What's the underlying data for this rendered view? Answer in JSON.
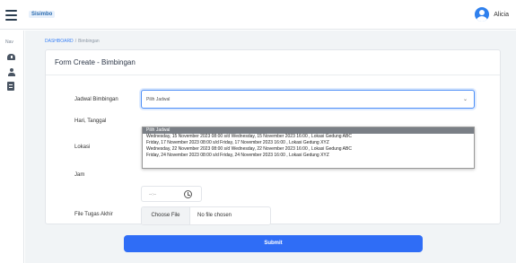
{
  "header": {
    "brand": "Sisimbo",
    "user_name": "Alicia"
  },
  "sidebar": {
    "nav_label": "Nav",
    "items": [
      "dashboard-icon",
      "user-icon",
      "document-icon"
    ]
  },
  "breadcrumb": {
    "home": "DASHBOARD",
    "separator": "/",
    "current": "Bimbingan"
  },
  "form": {
    "title": "Form Create - Bimbingan",
    "labels": {
      "jadwal": "Jadwal Bimbingan",
      "hari": "Hari, Tanggal",
      "lokasi": "Lokasi",
      "jam": "Jam",
      "file": "File Tugas Akhir"
    },
    "jadwal_select": {
      "value": "Pilih Jadwal",
      "options": [
        "Pilih Jadwal",
        "Wednesday, 15 November 2023 08:00 s/d Wednesday, 15 November 2023 16:00 , Lokasi Gedung ABC",
        "Friday, 17 November 2023 08:00 s/d Friday, 17 November 2023 16:00 , Lokasi Gedung XYZ",
        "Wednesday, 22 November 2023 08:00 s/d Wednesday, 22 November 2023 16:00 , Lokasi Gedung ABC",
        "Friday, 24 November 2023 08:00 s/d Friday, 24 November 2023 16:00 , Lokasi Gedung XYZ"
      ]
    },
    "jam_value": "--:--",
    "file_button": "Choose File",
    "file_status": "No file chosen",
    "submit_label": "Submit"
  },
  "colors": {
    "accent": "#2f6df6",
    "background": "#f1f4f6"
  }
}
